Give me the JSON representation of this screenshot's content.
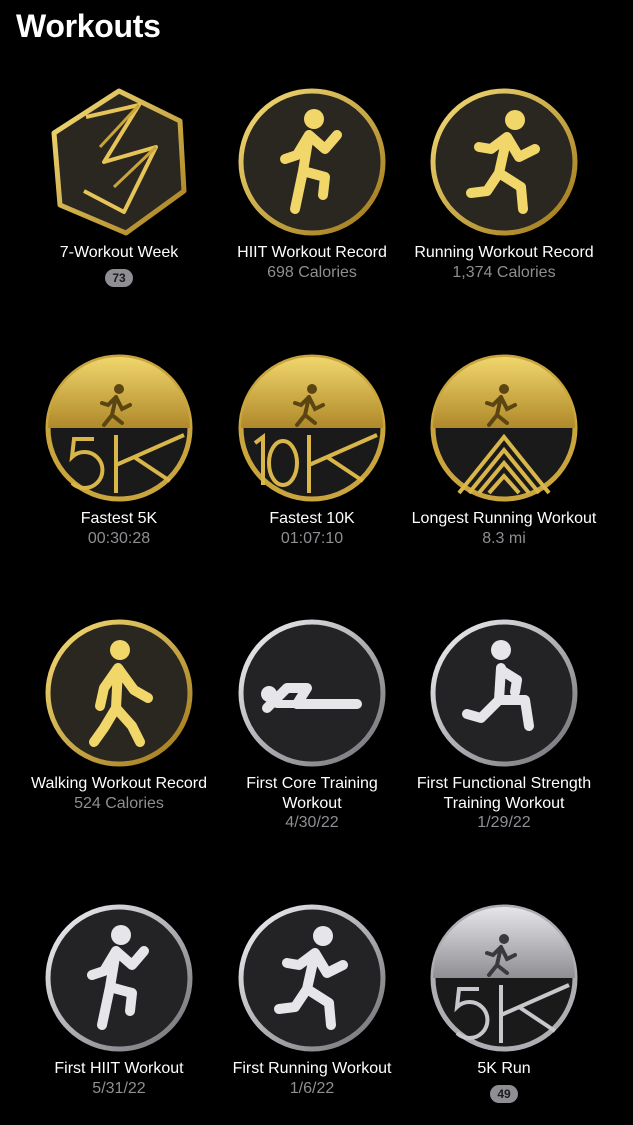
{
  "header": {
    "title": "Workouts"
  },
  "colors": {
    "gold": "#d4af37",
    "silver": "#c7c7cc",
    "secondary_text": "#8e8e93"
  },
  "awards": [
    {
      "name": "7-Workout Week",
      "detail": "",
      "count": "73",
      "style": "gold",
      "icon": "seven-workout-week-hexagon-icon"
    },
    {
      "name": "HIIT Workout Record",
      "detail": "698 Calories",
      "count": "",
      "style": "gold",
      "icon": "hiit-figure-icon"
    },
    {
      "name": "Running Workout Record",
      "detail": "1,374 Calories",
      "count": "",
      "style": "gold",
      "icon": "runner-icon"
    },
    {
      "name": "Fastest 5K",
      "detail": "00:30:28",
      "count": "",
      "style": "gold",
      "icon": "fastest-5k-icon"
    },
    {
      "name": "Fastest 10K",
      "detail": "01:07:10",
      "count": "",
      "style": "gold",
      "icon": "fastest-10k-icon"
    },
    {
      "name": "Longest Running Workout",
      "detail": "8.3 mi",
      "count": "",
      "style": "gold",
      "icon": "longest-run-chevrons-icon"
    },
    {
      "name": "Walking Workout Record",
      "detail": "524 Calories",
      "count": "",
      "style": "gold",
      "icon": "walker-icon"
    },
    {
      "name": "First Core Training Workout",
      "detail": "4/30/22",
      "count": "",
      "style": "silver",
      "icon": "core-training-figure-icon"
    },
    {
      "name": "First Functional Strength Training Workout",
      "detail": "1/29/22",
      "count": "",
      "style": "silver",
      "icon": "lunge-figure-icon"
    },
    {
      "name": "First HIIT Workout",
      "detail": "5/31/22",
      "count": "",
      "style": "silver",
      "icon": "hiit-figure-icon"
    },
    {
      "name": "First Running Workout",
      "detail": "1/6/22",
      "count": "",
      "style": "silver",
      "icon": "runner-icon"
    },
    {
      "name": "5K Run",
      "detail": "",
      "count": "49",
      "style": "silver",
      "icon": "five-k-run-icon"
    }
  ]
}
